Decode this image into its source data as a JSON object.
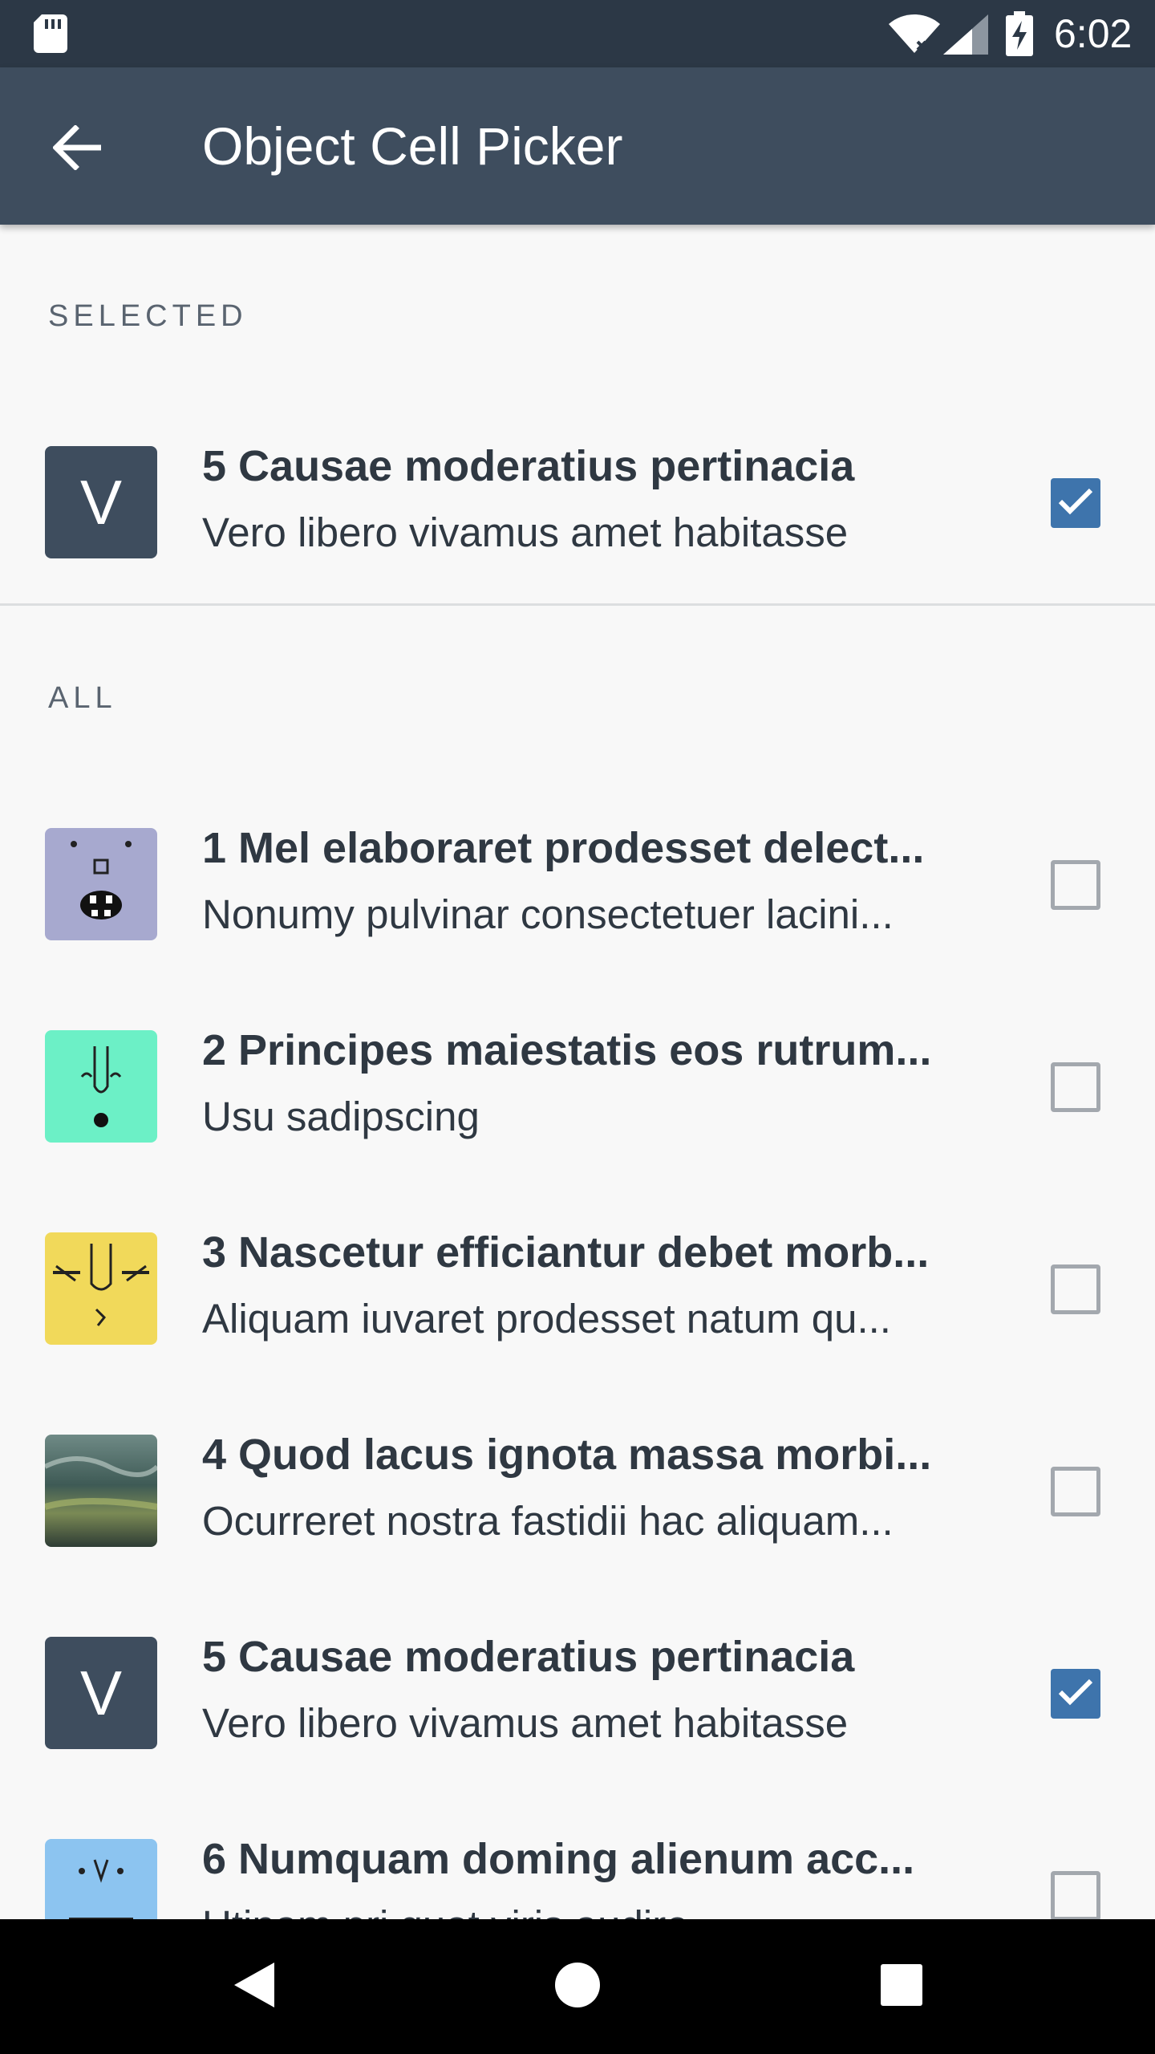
{
  "status_bar": {
    "time": "6:02",
    "icons": [
      "sd-card-icon",
      "wifi-icon",
      "signal-icon",
      "battery-charging-icon"
    ]
  },
  "app_bar": {
    "title": "Object Cell Picker",
    "back_icon": "arrow-back-icon"
  },
  "sections": {
    "selected_label": "SELECTED",
    "all_label": "ALL"
  },
  "selected_items": [
    {
      "avatar_letter": "V",
      "headline": "5 Causae moderatius pertinacia",
      "subhead": "Vero libero vivamus amet habitasse",
      "checked": true
    }
  ],
  "all_items": [
    {
      "avatar": "face-image-purple",
      "headline": "1 Mel elaboraret prodesset delect...",
      "subhead": "Nonumy pulvinar consectetuer lacini...",
      "checked": false
    },
    {
      "avatar": "face-image-green",
      "headline": "2 Principes maiestatis eos rutrum...",
      "subhead": "Usu sadipscing",
      "checked": false
    },
    {
      "avatar": "face-image-yellow",
      "headline": "3 Nascetur efficiantur debet morb...",
      "subhead": "Aliquam iuvaret prodesset natum qu...",
      "checked": false
    },
    {
      "avatar": "landscape-image",
      "headline": "4 Quod lacus ignota massa morbi...",
      "subhead": "Ocurreret nostra fastidii hac aliquam...",
      "checked": false
    },
    {
      "avatar_letter": "V",
      "headline": "5 Causae moderatius pertinacia",
      "subhead": "Vero libero vivamus amet habitasse",
      "checked": true
    },
    {
      "avatar": "face-image-blue",
      "headline": "6 Numquam doming alienum acc...",
      "subhead": "Utinam pri quot viris audire",
      "checked": false
    }
  ],
  "nav_bar": {
    "buttons": [
      "back-triangle-icon",
      "home-circle-icon",
      "recents-square-icon"
    ]
  },
  "colors": {
    "status_bar": "#2c3846",
    "app_bar": "#3e4d5e",
    "checkbox_checked": "#3e74ac",
    "text": "#2f3842"
  }
}
